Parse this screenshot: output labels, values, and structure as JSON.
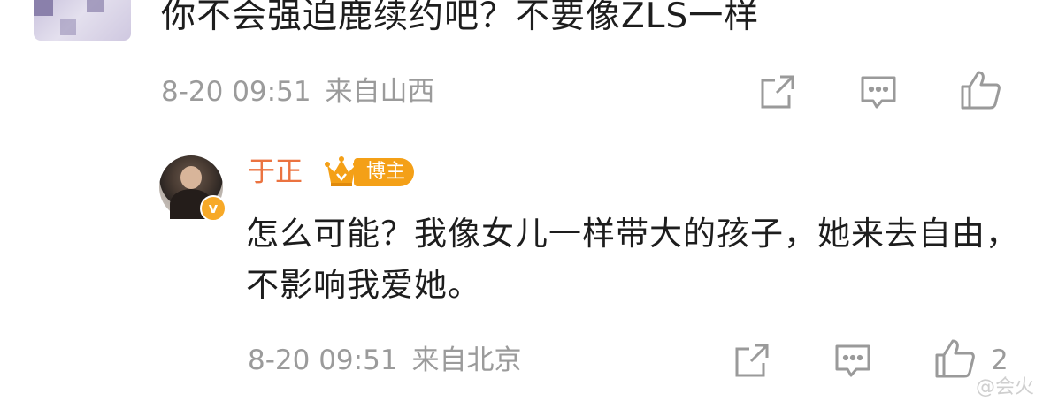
{
  "top_comment": {
    "text": "你不会强迫鹿续约吧？不要像ZLS一样",
    "date": "8-20 09:51",
    "location": "来自山西"
  },
  "reply": {
    "username": "于正",
    "author_badge": "博主",
    "text": "怎么可能？我像女儿一样带大的孩子，她来去自由，不影响我爱她。",
    "date": "8-20 09:51",
    "location": "来自北京",
    "like_count": "2"
  },
  "colors": {
    "username": "#eb7340",
    "badge": "#f4a017",
    "meta_gray": "#9b9b9b"
  },
  "icons": [
    "share-icon",
    "comment-icon",
    "like-icon",
    "crown-icon",
    "verified-badge-icon"
  ],
  "watermark": "@会火"
}
